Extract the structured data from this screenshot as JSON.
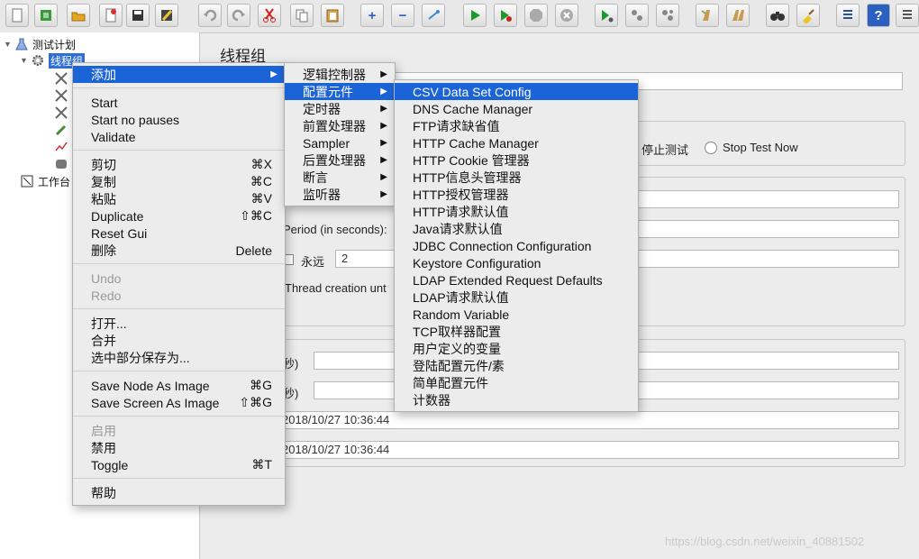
{
  "tree": {
    "root_label": "测试计划",
    "thread_group_label": "线程组",
    "workbench_label": "工作台"
  },
  "content": {
    "title": "线程组",
    "radio_stop_test": "停止测试",
    "radio_stop_test_now": "Stop Test Now",
    "ramp_up_label": "Period (in seconds):",
    "forever_label": "永远",
    "loop_count": "2",
    "thread_creation_label": "Thread creation unt",
    "duration_unit": "秒)",
    "delay_unit": "秒)",
    "start_time": "2018/10/27 10:36:44",
    "end_time": "2018/10/27 10:36:44"
  },
  "context_menu": {
    "add": "添加",
    "start": "Start",
    "start_no_pauses": "Start no pauses",
    "validate": "Validate",
    "cut": "剪切",
    "cut_key": "⌘X",
    "copy": "复制",
    "copy_key": "⌘C",
    "paste": "粘贴",
    "paste_key": "⌘V",
    "duplicate": "Duplicate",
    "duplicate_key": "⇧⌘C",
    "reset_gui": "Reset Gui",
    "delete": "删除",
    "delete_key": "Delete",
    "undo": "Undo",
    "redo": "Redo",
    "open": "打开...",
    "merge": "合并",
    "save_selection_as": "选中部分保存为...",
    "save_node_as_image": "Save Node As Image",
    "save_node_key": "⌘G",
    "save_screen_as_image": "Save Screen As Image",
    "save_screen_key": "⇧⌘G",
    "enable": "启用",
    "disable": "禁用",
    "toggle": "Toggle",
    "toggle_key": "⌘T",
    "help": "帮助"
  },
  "add_submenu": {
    "items": [
      "逻辑控制器",
      "配置元件",
      "定时器",
      "前置处理器",
      "Sampler",
      "后置处理器",
      "断言",
      "监听器"
    ]
  },
  "config_submenu": {
    "items": [
      "CSV Data Set Config",
      "DNS Cache Manager",
      "FTP请求缺省值",
      "HTTP Cache Manager",
      "HTTP Cookie 管理器",
      "HTTP信息头管理器",
      "HTTP授权管理器",
      "HTTP请求默认值",
      "Java请求默认值",
      "JDBC Connection Configuration",
      "Keystore Configuration",
      "LDAP Extended Request Defaults",
      "LDAP请求默认值",
      "Random Variable",
      "TCP取样器配置",
      "用户定义的变量",
      "登陆配置元件/素",
      "简单配置元件",
      "计数器"
    ]
  },
  "watermark": "https://blog.csdn.net/weixin_40881502",
  "colors": {
    "highlight": "#1b64d8",
    "tree_selected": "#2f6fd5",
    "menu_bg": "#ececec"
  }
}
